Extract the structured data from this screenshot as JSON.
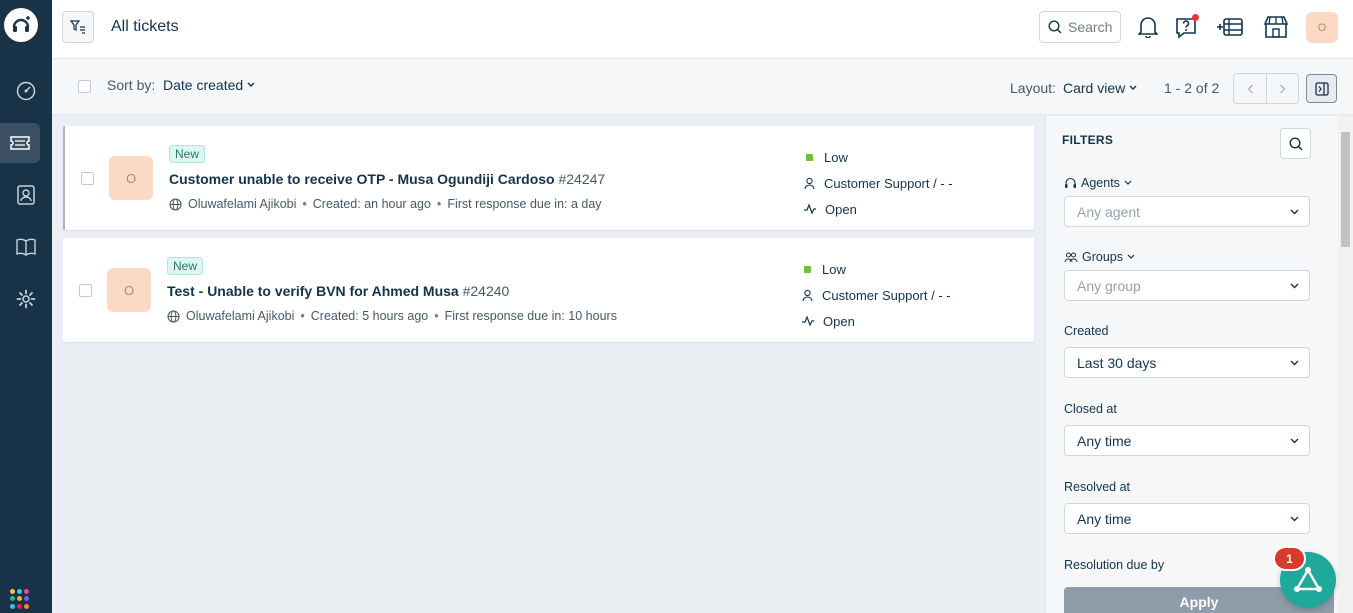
{
  "header": {
    "title": "All tickets",
    "search_label": "Search",
    "avatar_initial": "O"
  },
  "toolbar": {
    "sort_label": "Sort by:",
    "sort_value": "Date created",
    "layout_label": "Layout:",
    "layout_value": "Card view",
    "pagination": "1 - 2 of 2"
  },
  "tickets": [
    {
      "avatar_initial": "O",
      "status_badge": "New",
      "subject": "Customer unable to receive OTP - Musa Ogundiji Cardoso",
      "ticket_id": "#24247",
      "requester": "Oluwafelami Ajikobi",
      "created": "Created: an hour ago",
      "due": "First response due in: a day",
      "priority": "Low",
      "group": "Customer Support / - -",
      "status": "Open"
    },
    {
      "avatar_initial": "O",
      "status_badge": "New",
      "subject": "Test - Unable to verify BVN for Ahmed Musa",
      "ticket_id": "#24240",
      "requester": "Oluwafelami Ajikobi",
      "created": "Created: 5 hours ago",
      "due": "First response due in: 10 hours",
      "priority": "Low",
      "group": "Customer Support / - -",
      "status": "Open"
    }
  ],
  "filters": {
    "title": "FILTERS",
    "agents_label": "Agents",
    "agents_placeholder": "Any agent",
    "groups_label": "Groups",
    "groups_placeholder": "Any group",
    "created_label": "Created",
    "created_value": "Last 30 days",
    "closed_label": "Closed at",
    "closed_value": "Any time",
    "resolved_label": "Resolved at",
    "resolved_value": "Any time",
    "resolution_due_label": "Resolution due by",
    "apply_label": "Apply"
  },
  "fab": {
    "badge_count": "1"
  },
  "colors": {
    "nav_bg": "#183247",
    "priority_low": "#6fc040",
    "badge_new_bg": "#e0f5f1",
    "fab_bg": "#1fa99a"
  }
}
